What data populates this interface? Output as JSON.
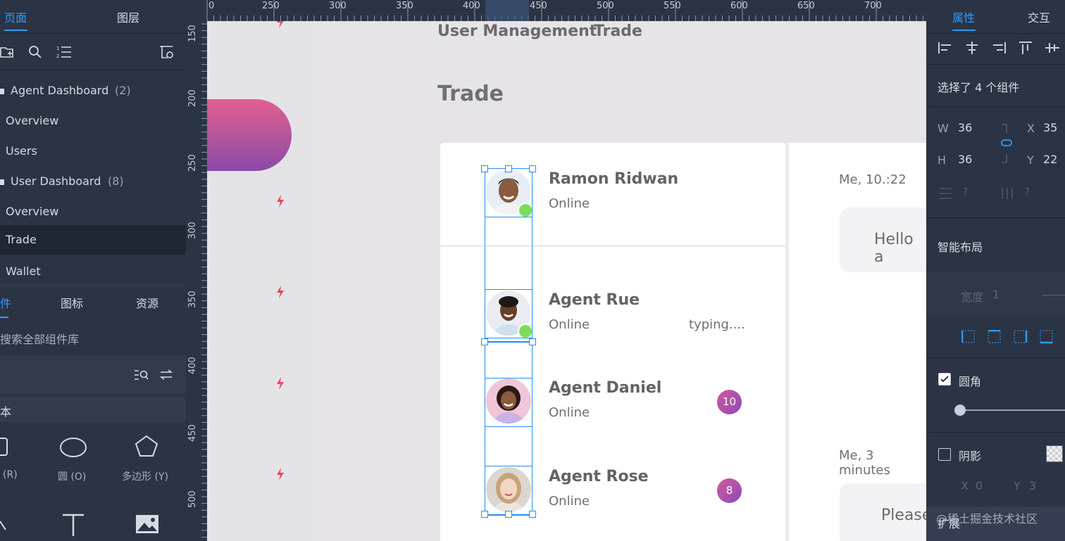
{
  "left_panel": {
    "tabs": [
      "页面",
      "图层"
    ],
    "pages": [
      {
        "label": "Agent Dashboard",
        "count": "(2)",
        "group": true
      },
      {
        "label": "Overview",
        "group": false
      },
      {
        "label": "Users",
        "group": false
      },
      {
        "label": "User Dashboard",
        "count": "(8)",
        "group": true
      },
      {
        "label": "Overview",
        "group": false
      },
      {
        "label": "Trade",
        "group": false,
        "selected": true
      },
      {
        "label": "Wallet",
        "group": false
      }
    ],
    "component_tabs": [
      "件",
      "图标",
      "资源"
    ],
    "search_placeholder": "搜索全部组件库",
    "category": "本",
    "shapes": [
      {
        "label": "(R)"
      },
      {
        "label": "圆 (O)"
      },
      {
        "label": "多边形 (Y)"
      }
    ]
  },
  "ruler": {
    "h_ticks": [
      "0",
      "250",
      "300",
      "350",
      "400",
      "450",
      "500",
      "550",
      "600",
      "650",
      "700"
    ],
    "v_ticks": [
      "150",
      "200",
      "250",
      "300",
      "350",
      "400",
      "450",
      "500"
    ]
  },
  "canvas": {
    "nav": [
      "User Management",
      "Trade"
    ],
    "page_title": "Trade",
    "agents": [
      {
        "name": "Ramon Ridwan",
        "status": "Online",
        "online": true
      },
      {
        "name": "Agent Rue",
        "status": "Online",
        "extra": "typing....",
        "online": true
      },
      {
        "name": "Agent Daniel",
        "status": "Online",
        "badge": "10"
      },
      {
        "name": "Agent Rose",
        "status": "Online",
        "badge": "8"
      }
    ],
    "messages": [
      {
        "time": "Me, 10.:22",
        "text": "Hello a"
      },
      {
        "time": "Me, 3 minutes",
        "text": "Please"
      }
    ]
  },
  "right_panel": {
    "tabs": [
      "属性",
      "交互"
    ],
    "selection_info": "选择了 4 个组件",
    "dims": {
      "w_label": "W",
      "w": "36",
      "h_label": "H",
      "h": "36",
      "x_label": "X",
      "x": "35",
      "y_label": "Y",
      "y": "22"
    },
    "dim_placeholders": [
      "?",
      "?"
    ],
    "smart_layout": "智能布局",
    "width_label": "宽度",
    "width_value": "1",
    "rounded_label": "圆角",
    "shadow_label": "阴影",
    "shadow_xy": [
      "X",
      "0",
      "Y",
      "3"
    ],
    "expand_label": "扩展",
    "watermark": "@稀土掘金技术社区"
  },
  "colors": {
    "accent": "#2f9bff",
    "panel": "#2b3444",
    "badge_from": "#d05a9e",
    "badge_to": "#8e4ab6",
    "online": "#7ddc5c"
  }
}
